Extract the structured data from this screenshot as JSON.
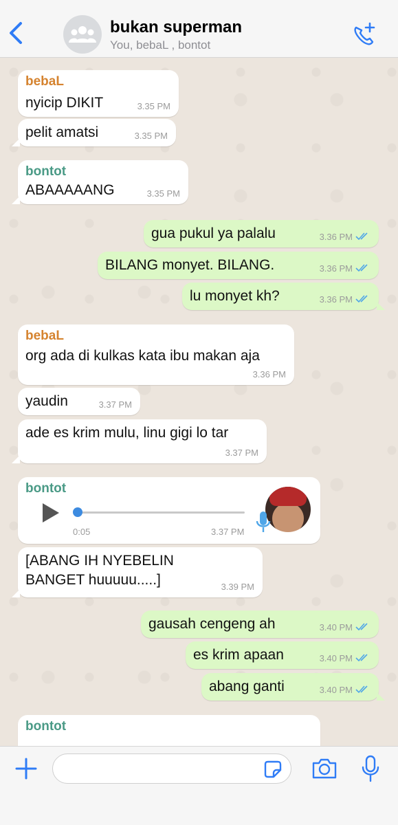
{
  "header": {
    "title": "bukan superman",
    "subtitle": "You, bebaL , bontot",
    "back_icon": "chevron-left-icon",
    "call_icon": "add-call-icon"
  },
  "colors": {
    "accent": "#2f7cf6",
    "incoming_bubble": "#ffffff",
    "outgoing_bubble": "#dcf8c6",
    "sender_bebal": "#d5832f",
    "sender_bontot": "#4a9a86",
    "read_ticks": "#4fa6e8"
  },
  "messages": [
    {
      "id": "m1",
      "direction": "in",
      "sender": "bebaL",
      "text": "nyicip DIKIT",
      "time": "3.35 PM"
    },
    {
      "id": "m2",
      "direction": "in",
      "text": "pelit amatsi",
      "time": "3.35 PM"
    },
    {
      "id": "m3",
      "direction": "in",
      "sender": "bontot",
      "text": "ABAAAAANG",
      "time": "3.35 PM"
    },
    {
      "id": "m4",
      "direction": "out",
      "text": "gua pukul ya palalu",
      "time": "3.36 PM",
      "status": "read"
    },
    {
      "id": "m5",
      "direction": "out",
      "text": "BILANG monyet. BILANG.",
      "time": "3.36 PM",
      "status": "read"
    },
    {
      "id": "m6",
      "direction": "out",
      "text": "lu monyet kh?",
      "time": "3.36 PM",
      "status": "read"
    },
    {
      "id": "m7",
      "direction": "in",
      "sender": "bebaL",
      "text": "org ada di kulkas kata ibu makan aja",
      "time": "3.36 PM"
    },
    {
      "id": "m8",
      "direction": "in",
      "text": "yaudin",
      "time": "3.37 PM"
    },
    {
      "id": "m9",
      "direction": "in",
      "text": "ade es krim mulu, linu gigi lo tar",
      "time": "3.37 PM"
    },
    {
      "id": "m10",
      "direction": "in",
      "sender": "bontot",
      "type": "voice",
      "duration": "0:05",
      "time": "3.37 PM",
      "progress": 0
    },
    {
      "id": "m11",
      "direction": "in",
      "text": "[ABANG IH NYEBELIN BANGET huuuuu.....]",
      "time": "3.39 PM"
    },
    {
      "id": "m12",
      "direction": "out",
      "text": "gausah cengeng ah",
      "time": "3.40 PM",
      "status": "read"
    },
    {
      "id": "m13",
      "direction": "out",
      "text": "es krim apaan",
      "time": "3.40 PM",
      "status": "read"
    },
    {
      "id": "m14",
      "direction": "out",
      "text": "abang ganti",
      "time": "3.40 PM",
      "status": "read"
    },
    {
      "id": "m15",
      "direction": "in",
      "sender": "bontot",
      "text": "",
      "time": ""
    }
  ],
  "input_bar": {
    "placeholder": "",
    "value": "",
    "icons": [
      "plus-icon",
      "sticker-icon",
      "camera-icon",
      "microphone-icon"
    ]
  }
}
